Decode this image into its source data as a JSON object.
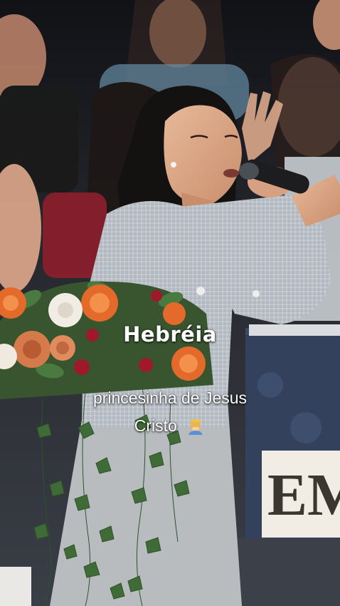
{
  "overlay": {
    "title": "Hebréia",
    "subtitle_line1": "princesinha de Jesus",
    "subtitle_line2": "Cristo",
    "emoji_icon": "woman-with-crown-emoji"
  },
  "backdrop_sign_text": "EM",
  "colors": {
    "caption_text": "#ffffff",
    "jacket": "#c4c9cf",
    "skirt": "#b9bcbf",
    "flowers_orange": "#e36a2a",
    "leaves": "#3f6b37"
  }
}
